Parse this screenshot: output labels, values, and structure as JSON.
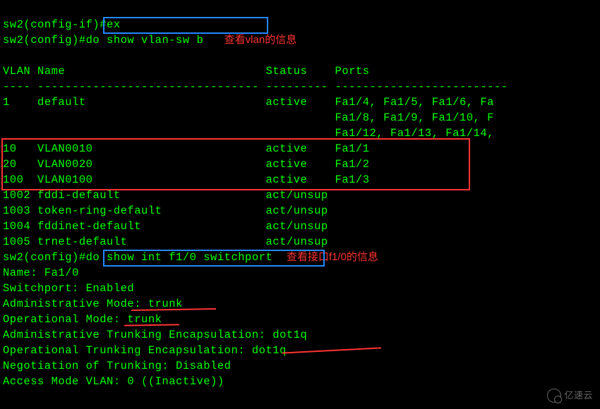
{
  "prompt1": "sw2(config-if)#",
  "cmd1": "ex",
  "prompt2": "sw2(config)#",
  "cmd2": "do show vlan-sw b",
  "annotation1": "查看vlan的信息",
  "header": {
    "vlan": "VLAN",
    "name": "Name",
    "status": "Status",
    "ports": "Ports"
  },
  "sep1": "----",
  "sep2": "--------------------------------",
  "sep3": "---------",
  "sep4": "-------------------------",
  "vlan_default": {
    "id": "1",
    "name": "default",
    "status": "active",
    "ports1": "Fa1/4, Fa1/5, Fa1/6, Fa",
    "ports2": "Fa1/8, Fa1/9, Fa1/10, F",
    "ports3": "Fa1/12, Fa1/13, Fa1/14,"
  },
  "vlan_rows": [
    {
      "id": "10",
      "name": "VLAN0010",
      "status": "active",
      "ports": "Fa1/1"
    },
    {
      "id": "20",
      "name": "VLAN0020",
      "status": "active",
      "ports": "Fa1/2"
    },
    {
      "id": "100",
      "name": "VLAN0100",
      "status": "active",
      "ports": "Fa1/3"
    }
  ],
  "vlan_sys": [
    {
      "id": "1002",
      "name": "fddi-default",
      "status": "act/unsup"
    },
    {
      "id": "1003",
      "name": "token-ring-default",
      "status": "act/unsup"
    },
    {
      "id": "1004",
      "name": "fddinet-default",
      "status": "act/unsup"
    },
    {
      "id": "1005",
      "name": "trnet-default",
      "status": "act/unsup"
    }
  ],
  "cmd3": "do show int f1/0 switchport",
  "annotation2": "查看接口f1/0的信息",
  "sp": {
    "l1": "Name: Fa1/0",
    "l2": "Switchport: Enabled",
    "l3": "Administrative Mode: trunk",
    "l4": "Operational Mode: trunk",
    "l5": "Administrative Trunking Encapsulation: dot1q",
    "l6": "Operational Trunking Encapsulation: dot1q",
    "l7": "Negotiation of Trunking: Disabled",
    "l8": "Access Mode VLAN: 0 ((Inactive))"
  },
  "watermark": "亿速云",
  "chart_data": {
    "type": "table",
    "title": "show vlan-sw b",
    "columns": [
      "VLAN",
      "Name",
      "Status",
      "Ports"
    ],
    "rows": [
      [
        "1",
        "default",
        "active",
        "Fa1/4, Fa1/5, Fa1/6, Fa1/8, Fa1/9, Fa1/10, Fa1/12, Fa1/13, Fa1/14"
      ],
      [
        "10",
        "VLAN0010",
        "active",
        "Fa1/1"
      ],
      [
        "20",
        "VLAN0020",
        "active",
        "Fa1/2"
      ],
      [
        "100",
        "VLAN0100",
        "active",
        "Fa1/3"
      ],
      [
        "1002",
        "fddi-default",
        "act/unsup",
        ""
      ],
      [
        "1003",
        "token-ring-default",
        "act/unsup",
        ""
      ],
      [
        "1004",
        "fddinet-default",
        "act/unsup",
        ""
      ],
      [
        "1005",
        "trnet-default",
        "act/unsup",
        ""
      ]
    ]
  }
}
